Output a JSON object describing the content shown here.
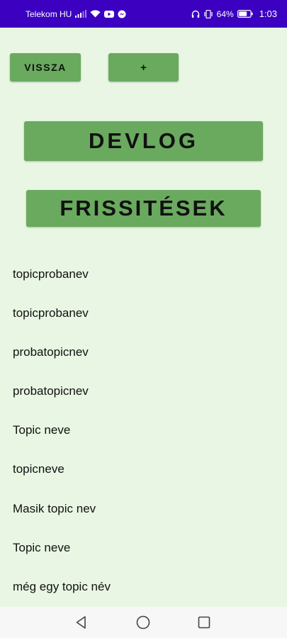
{
  "status_bar": {
    "carrier": "Telekom HU",
    "battery_percent": "64%",
    "time": "1:03",
    "icons": [
      "signal-icon",
      "wifi-icon",
      "youtube-icon",
      "messenger-icon",
      "headset-icon",
      "vibrate-icon",
      "battery-icon"
    ]
  },
  "toolbar": {
    "back_label": "VISSZA",
    "add_label": "+"
  },
  "sections": {
    "devlog_label": "DEVLOG",
    "updates_label": "FRISSITÉSEK"
  },
  "topics": [
    "topicprobanev",
    "topicprobanev",
    "probatopicnev",
    "probatopicnev",
    "Topic neve",
    "topicneve",
    "Masik topic nev",
    "Topic neve",
    "még egy topic név"
  ],
  "colors": {
    "status_bar": "#3b00c0",
    "background": "#e8f6e3",
    "button": "#6aaa5f"
  }
}
